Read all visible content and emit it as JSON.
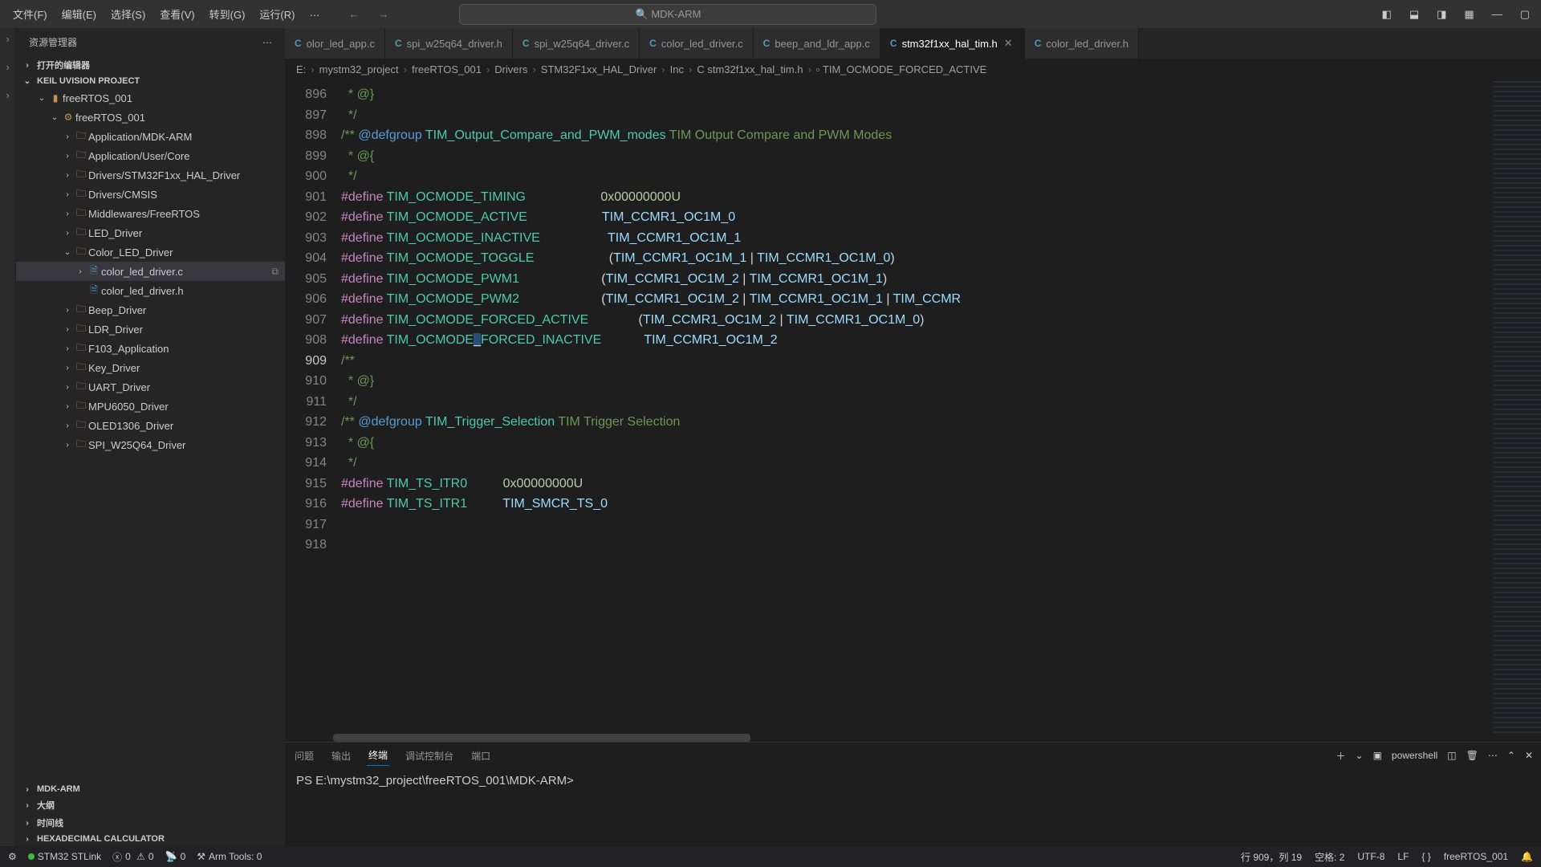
{
  "menu": {
    "items": [
      "文件(F)",
      "编辑(E)",
      "选择(S)",
      "查看(V)",
      "转到(G)",
      "运行(R)",
      "…"
    ]
  },
  "search": {
    "placeholder": "MDK-ARM"
  },
  "sidebar": {
    "title": "资源管理器",
    "openEditors": "打开的编辑器",
    "projectSection": "KEIL UVISION PROJECT",
    "tree": {
      "root": "freeRTOS_001",
      "target": "freeRTOS_001",
      "groups": [
        "Application/MDK-ARM",
        "Application/User/Core",
        "Drivers/STM32F1xx_HAL_Driver",
        "Drivers/CMSIS",
        "Middlewares/FreeRTOS",
        "LED_Driver",
        "Color_LED_Driver",
        "Beep_Driver",
        "LDR_Driver",
        "F103_Application",
        "Key_Driver",
        "UART_Driver",
        "MPU6050_Driver",
        "OLED1306_Driver",
        "SPI_W25Q64_Driver"
      ],
      "colorFiles": [
        "color_led_driver.c",
        "color_led_driver.h"
      ]
    },
    "bottomSections": [
      "MDK-ARM",
      "大纲",
      "时间线",
      "HEXADECIMAL CALCULATOR"
    ]
  },
  "tabs": [
    {
      "label": "color_led_app.c",
      "lang": "C",
      "active": false,
      "trunc": true
    },
    {
      "label": "spi_w25q64_driver.h",
      "lang": "C",
      "active": false
    },
    {
      "label": "spi_w25q64_driver.c",
      "lang": "C",
      "active": false
    },
    {
      "label": "color_led_driver.c",
      "lang": "C",
      "active": false
    },
    {
      "label": "beep_and_ldr_app.c",
      "lang": "C",
      "active": false
    },
    {
      "label": "stm32f1xx_hal_tim.h",
      "lang": "C",
      "active": true
    },
    {
      "label": "color_led_driver.h",
      "lang": "C",
      "active": false
    }
  ],
  "breadcrumb": [
    "E:",
    "mystm32_project",
    "freeRTOS_001",
    "Drivers",
    "STM32F1xx_HAL_Driver",
    "Inc",
    "stm32f1xx_hal_tim.h",
    "TIM_OCMODE_FORCED_ACTIVE"
  ],
  "code": {
    "startLine": 896,
    "currentLine": 909,
    "lines": [
      {
        "n": 896,
        "seg": [
          {
            "c": "k-cmt",
            "t": "  * @}"
          }
        ]
      },
      {
        "n": 897,
        "seg": [
          {
            "c": "k-cmt",
            "t": "  */"
          }
        ]
      },
      {
        "n": 898,
        "seg": [
          {
            "c": "",
            "t": ""
          }
        ]
      },
      {
        "n": 899,
        "seg": [
          {
            "c": "k-cmt",
            "t": "/** "
          },
          {
            "c": "k-doc",
            "t": "@defgroup"
          },
          {
            "c": "k-cmt",
            "t": " "
          },
          {
            "c": "k-doc-id",
            "t": "TIM_Output_Compare_and_PWM_modes"
          },
          {
            "c": "k-cmt",
            "t": " TIM Output Compare and PWM Modes"
          }
        ]
      },
      {
        "n": 900,
        "seg": [
          {
            "c": "k-cmt",
            "t": "  * @{"
          }
        ]
      },
      {
        "n": 901,
        "seg": [
          {
            "c": "k-cmt",
            "t": "  */"
          }
        ]
      },
      {
        "n": 902,
        "seg": [
          {
            "c": "k-def",
            "t": "#define"
          },
          {
            "c": "",
            "t": " "
          },
          {
            "c": "k-id",
            "t": "TIM_OCMODE_TIMING"
          },
          {
            "c": "",
            "t": "                     "
          },
          {
            "c": "k-num",
            "t": "0x00000000U"
          }
        ]
      },
      {
        "n": 903,
        "seg": [
          {
            "c": "k-def",
            "t": "#define"
          },
          {
            "c": "",
            "t": " "
          },
          {
            "c": "k-id",
            "t": "TIM_OCMODE_ACTIVE"
          },
          {
            "c": "",
            "t": "                     "
          },
          {
            "c": "k-id2",
            "t": "TIM_CCMR1_OC1M_0"
          }
        ]
      },
      {
        "n": 904,
        "seg": [
          {
            "c": "k-def",
            "t": "#define"
          },
          {
            "c": "",
            "t": " "
          },
          {
            "c": "k-id",
            "t": "TIM_OCMODE_INACTIVE"
          },
          {
            "c": "",
            "t": "                   "
          },
          {
            "c": "k-id2",
            "t": "TIM_CCMR1_OC1M_1"
          }
        ]
      },
      {
        "n": 905,
        "seg": [
          {
            "c": "k-def",
            "t": "#define"
          },
          {
            "c": "",
            "t": " "
          },
          {
            "c": "k-id",
            "t": "TIM_OCMODE_TOGGLE"
          },
          {
            "c": "",
            "t": "                     "
          },
          {
            "c": "k-par",
            "t": "("
          },
          {
            "c": "k-id2",
            "t": "TIM_CCMR1_OC1M_1"
          },
          {
            "c": "k-op",
            "t": " | "
          },
          {
            "c": "k-id2",
            "t": "TIM_CCMR1_OC1M_0"
          },
          {
            "c": "k-par",
            "t": ")"
          }
        ]
      },
      {
        "n": 906,
        "seg": [
          {
            "c": "k-def",
            "t": "#define"
          },
          {
            "c": "",
            "t": " "
          },
          {
            "c": "k-id",
            "t": "TIM_OCMODE_PWM1"
          },
          {
            "c": "",
            "t": "                       "
          },
          {
            "c": "k-par",
            "t": "("
          },
          {
            "c": "k-id2",
            "t": "TIM_CCMR1_OC1M_2"
          },
          {
            "c": "k-op",
            "t": " | "
          },
          {
            "c": "k-id2",
            "t": "TIM_CCMR1_OC1M_1"
          },
          {
            "c": "k-par",
            "t": ")"
          }
        ]
      },
      {
        "n": 907,
        "seg": [
          {
            "c": "k-def",
            "t": "#define"
          },
          {
            "c": "",
            "t": " "
          },
          {
            "c": "k-id",
            "t": "TIM_OCMODE_PWM2"
          },
          {
            "c": "",
            "t": "                       "
          },
          {
            "c": "k-par",
            "t": "("
          },
          {
            "c": "k-id2",
            "t": "TIM_CCMR1_OC1M_2"
          },
          {
            "c": "k-op",
            "t": " | "
          },
          {
            "c": "k-id2",
            "t": "TIM_CCMR1_OC1M_1"
          },
          {
            "c": "k-op",
            "t": " | "
          },
          {
            "c": "k-id2",
            "t": "TIM_CCMR"
          }
        ]
      },
      {
        "n": 908,
        "seg": [
          {
            "c": "k-def",
            "t": "#define"
          },
          {
            "c": "",
            "t": " "
          },
          {
            "c": "k-id",
            "t": "TIM_OCMODE_FORCED_ACTIVE"
          },
          {
            "c": "",
            "t": "              "
          },
          {
            "c": "k-par",
            "t": "("
          },
          {
            "c": "k-id2",
            "t": "TIM_CCMR1_OC1M_2"
          },
          {
            "c": "k-op",
            "t": " | "
          },
          {
            "c": "k-id2",
            "t": "TIM_CCMR1_OC1M_0"
          },
          {
            "c": "k-par",
            "t": ")"
          }
        ]
      },
      {
        "n": 909,
        "seg": [
          {
            "c": "k-def",
            "t": "#define"
          },
          {
            "c": "",
            "t": " "
          },
          {
            "c": "k-id",
            "t": "TIM_OCMODE"
          },
          {
            "c": "cursor-mark",
            "t": "_"
          },
          {
            "c": "k-id",
            "t": "FORCED_INACTIVE"
          },
          {
            "c": "",
            "t": "            "
          },
          {
            "c": "k-id2",
            "t": "TIM_CCMR1_OC1M_2"
          }
        ]
      },
      {
        "n": 910,
        "seg": [
          {
            "c": "k-cmt",
            "t": "/**"
          }
        ]
      },
      {
        "n": 911,
        "seg": [
          {
            "c": "k-cmt",
            "t": "  * @}"
          }
        ]
      },
      {
        "n": 912,
        "seg": [
          {
            "c": "k-cmt",
            "t": "  */"
          }
        ]
      },
      {
        "n": 913,
        "seg": [
          {
            "c": "",
            "t": ""
          }
        ]
      },
      {
        "n": 914,
        "seg": [
          {
            "c": "k-cmt",
            "t": "/** "
          },
          {
            "c": "k-doc",
            "t": "@defgroup"
          },
          {
            "c": "k-cmt",
            "t": " "
          },
          {
            "c": "k-doc-id",
            "t": "TIM_Trigger_Selection"
          },
          {
            "c": "k-cmt",
            "t": " TIM Trigger Selection"
          }
        ]
      },
      {
        "n": 915,
        "seg": [
          {
            "c": "k-cmt",
            "t": "  * @{"
          }
        ]
      },
      {
        "n": 916,
        "seg": [
          {
            "c": "k-cmt",
            "t": "  */"
          }
        ]
      },
      {
        "n": 917,
        "seg": [
          {
            "c": "k-def",
            "t": "#define"
          },
          {
            "c": "",
            "t": " "
          },
          {
            "c": "k-id",
            "t": "TIM_TS_ITR0"
          },
          {
            "c": "",
            "t": "          "
          },
          {
            "c": "k-num",
            "t": "0x00000000U"
          }
        ]
      },
      {
        "n": 918,
        "seg": [
          {
            "c": "k-def",
            "t": "#define"
          },
          {
            "c": "",
            "t": " "
          },
          {
            "c": "k-id",
            "t": "TIM_TS_ITR1"
          },
          {
            "c": "",
            "t": "          "
          },
          {
            "c": "k-id2",
            "t": "TIM_SMCR_TS_0"
          }
        ]
      }
    ]
  },
  "panel": {
    "tabs": [
      "问题",
      "输出",
      "终端",
      "调试控制台",
      "端口"
    ],
    "activeTab": "终端",
    "shell": "powershell",
    "prompt": "PS E:\\mystm32_project\\freeRTOS_001\\MDK-ARM>"
  },
  "status": {
    "link": "STM32 STLink",
    "errors": "0",
    "warnings": "0",
    "radio": "0",
    "armTools": "Arm Tools: 0",
    "lineCol": "行 909，列 19",
    "spaces": "空格: 2",
    "encoding": "UTF-8",
    "eol": "LF",
    "lang": "{ }",
    "project": "freeRTOS_001"
  }
}
